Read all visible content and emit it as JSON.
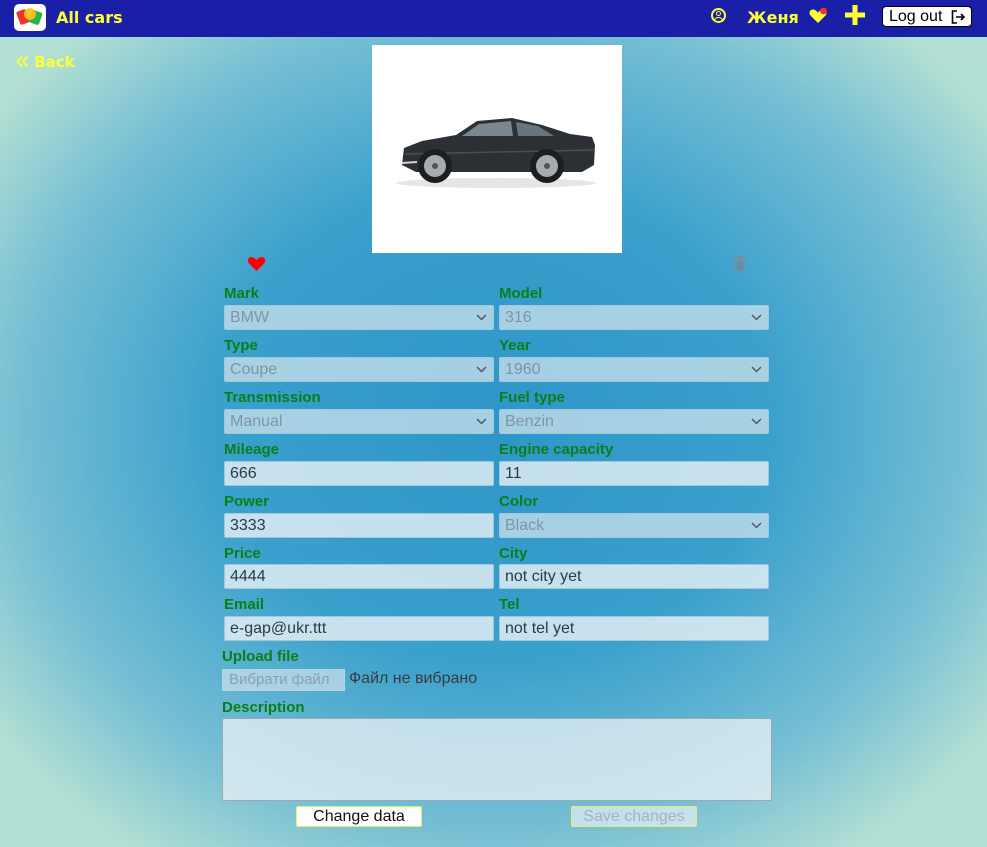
{
  "header": {
    "title": "All cars",
    "username": "Женя",
    "logout_label": "Log out"
  },
  "nav": {
    "back_label": "Back"
  },
  "car": {
    "fields": {
      "mark": {
        "label": "Mark",
        "value": "BMW"
      },
      "model": {
        "label": "Model",
        "value": "316"
      },
      "type": {
        "label": "Type",
        "value": "Coupe"
      },
      "year": {
        "label": "Year",
        "value": "1960"
      },
      "transmission": {
        "label": "Transmission",
        "value": "Manual"
      },
      "fuel_type": {
        "label": "Fuel type",
        "value": "Benzin"
      },
      "mileage": {
        "label": "Mileage",
        "value": "666"
      },
      "engine_capacity": {
        "label": "Engine capacity",
        "value": "11"
      },
      "power": {
        "label": "Power",
        "value": "3333"
      },
      "color": {
        "label": "Color",
        "value": "Black"
      },
      "price": {
        "label": "Price",
        "value": "4444"
      },
      "city": {
        "label": "City",
        "value": "not city yet"
      },
      "email": {
        "label": "Email",
        "value": "e-gap@ukr.ttt"
      },
      "tel": {
        "label": "Tel",
        "value": "not tel yet"
      }
    },
    "upload": {
      "label": "Upload file",
      "button_label": "Вибрати файл",
      "status": "Файл не вибрано"
    },
    "description": {
      "label": "Description",
      "value": ""
    }
  },
  "actions": {
    "change_label": "Change data",
    "save_label": "Save changes"
  },
  "colors": {
    "topbar": "#1a1fa8",
    "accent": "#ffff33",
    "label_green": "#0a7f18",
    "favorite_red": "#ff0000"
  },
  "icons": [
    "app-logo",
    "user-circle-icon",
    "favorites-heart-icon",
    "plus-icon",
    "logout-icon",
    "double-chevron-left-icon",
    "heart-icon",
    "trash-icon",
    "chevron-down-icon"
  ]
}
